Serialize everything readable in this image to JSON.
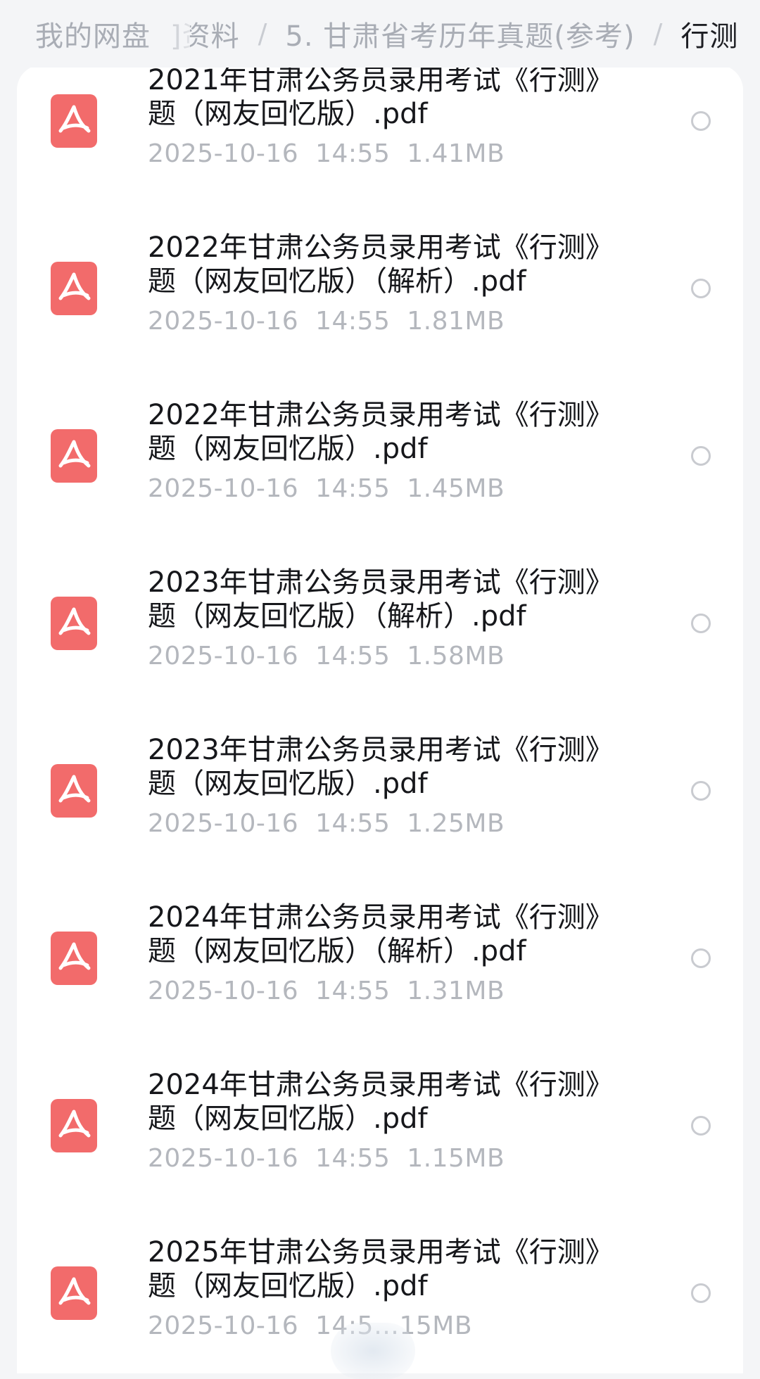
{
  "breadcrumb": {
    "root": "我的网盘",
    "partial": "]资料",
    "folder": "5. 甘肃省考历年真题(参考)",
    "current": "行测",
    "separator": "/"
  },
  "files": [
    {
      "name": "2021年甘肃公务员录用考试《行测》\n题（网友回忆版）.pdf",
      "meta": "2025-10-16  14:55  1.41MB",
      "icon": "pdf-icon"
    },
    {
      "name": "2022年甘肃公务员录用考试《行测》\n题（网友回忆版）（解析）.pdf",
      "meta": "2025-10-16  14:55  1.81MB",
      "icon": "pdf-icon"
    },
    {
      "name": "2022年甘肃公务员录用考试《行测》\n题（网友回忆版）.pdf",
      "meta": "2025-10-16  14:55  1.45MB",
      "icon": "pdf-icon"
    },
    {
      "name": "2023年甘肃公务员录用考试《行测》\n题（网友回忆版）（解析）.pdf",
      "meta": "2025-10-16  14:55  1.58MB",
      "icon": "pdf-icon"
    },
    {
      "name": "2023年甘肃公务员录用考试《行测》\n题（网友回忆版）.pdf",
      "meta": "2025-10-16  14:55  1.25MB",
      "icon": "pdf-icon"
    },
    {
      "name": "2024年甘肃公务员录用考试《行测》\n题（网友回忆版）（解析）.pdf",
      "meta": "2025-10-16  14:55  1.31MB",
      "icon": "pdf-icon"
    },
    {
      "name": "2024年甘肃公务员录用考试《行测》\n题（网友回忆版）.pdf",
      "meta": "2025-10-16  14:55  1.15MB",
      "icon": "pdf-icon"
    },
    {
      "name": "2025年甘肃公务员录用考试《行测》\n题（网友回忆版）.pdf",
      "meta": "2025-10-16  14:5…15MB",
      "icon": "pdf-icon"
    }
  ],
  "colors": {
    "pdf_icon": "#f26b6b",
    "text_primary": "#16171b",
    "text_secondary": "#b4b7bd",
    "breadcrumb_inactive": "#a9adb5"
  }
}
